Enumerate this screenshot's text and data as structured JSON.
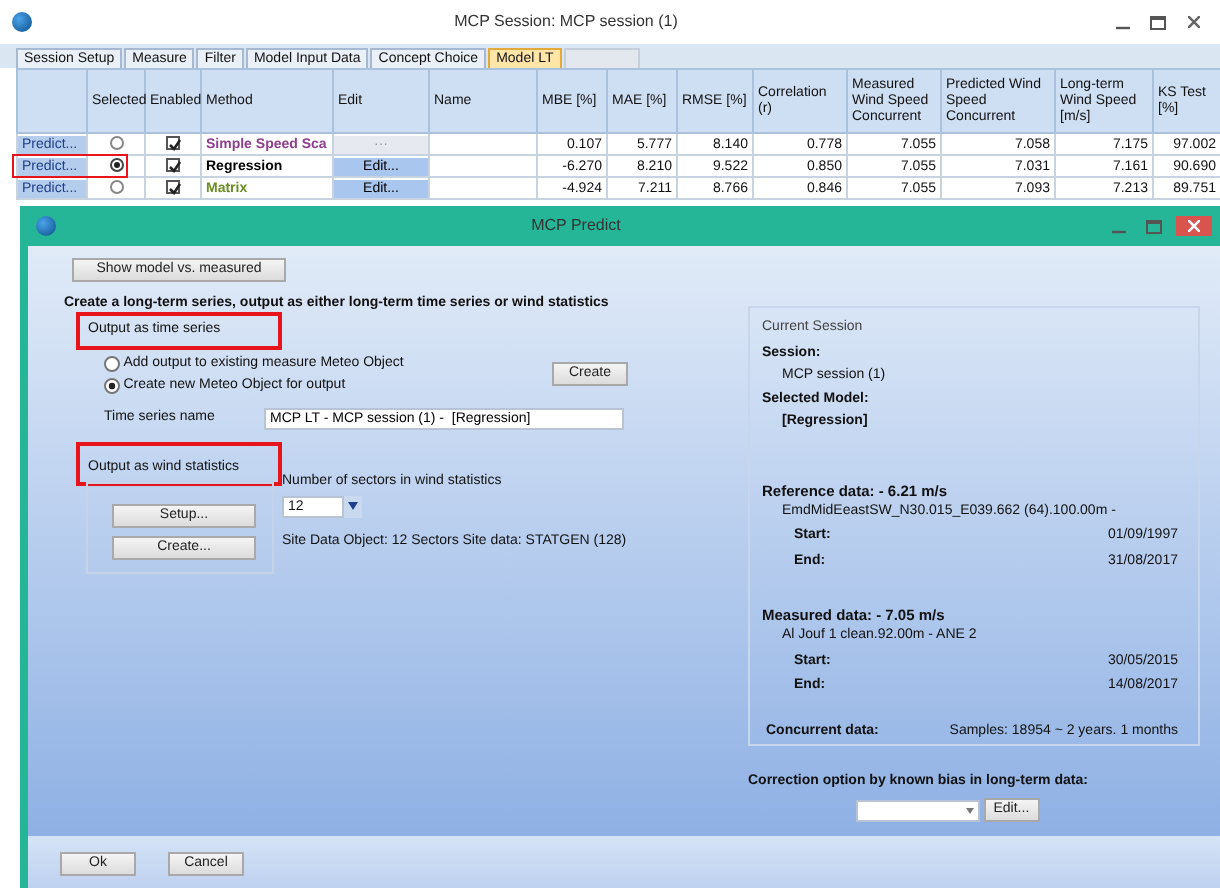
{
  "main_window": {
    "title": "MCP Session: MCP session (1)"
  },
  "tabs": [
    {
      "label": "Session Setup",
      "selected": false
    },
    {
      "label": "Measure",
      "selected": false
    },
    {
      "label": "Filter",
      "selected": false
    },
    {
      "label": "Model Input Data",
      "selected": false
    },
    {
      "label": "Concept Choice",
      "selected": false
    },
    {
      "label": "Model LT",
      "selected": true
    }
  ],
  "table": {
    "columns": [
      "",
      "Selected",
      "Enabled",
      "Method",
      "Edit",
      "Name",
      "MBE [%]",
      "MAE [%]",
      "RMSE [%]",
      "Correlation (r)",
      "Measured Wind Speed Concurrent",
      "Predicted Wind Speed Concurrent",
      "Long-term Wind Speed [m/s]",
      "KS Test [%]"
    ],
    "rows": [
      {
        "button": "Predict...",
        "selected": false,
        "enabled": true,
        "method": "Simple Speed Sca",
        "color": "#8e3f8e",
        "edit": {
          "label": "···",
          "disabled": true
        },
        "values": [
          "0.107",
          "5.777",
          "8.140",
          "0.778",
          "7.055",
          "7.058",
          "7.175",
          "97.002"
        ],
        "highlighted": false
      },
      {
        "button": "Predict...",
        "selected": true,
        "enabled": true,
        "method": "Regression",
        "color": "#000000",
        "edit": {
          "label": "Edit...",
          "disabled": false
        },
        "values": [
          "-6.270",
          "8.210",
          "9.522",
          "0.850",
          "7.055",
          "7.031",
          "7.161",
          "90.690"
        ],
        "highlighted": true
      },
      {
        "button": "Predict...",
        "selected": false,
        "enabled": true,
        "method": "Matrix",
        "color": "#6b8e23",
        "edit": {
          "label": "Edit...",
          "disabled": false
        },
        "values": [
          "-4.924",
          "7.211",
          "8.766",
          "0.846",
          "7.055",
          "7.093",
          "7.213",
          "89.751"
        ],
        "highlighted": false
      }
    ]
  },
  "dialog": {
    "title": "MCP Predict",
    "show_button": "Show model vs. measured",
    "heading": "Create a long-term series, output as either long-term time series or wind statistics",
    "time_series": {
      "label": "Output as time series",
      "highlighted": true,
      "options": [
        {
          "label": "Add output to existing measure Meteo Object",
          "selected": false
        },
        {
          "label": "Create new Meteo Object for output",
          "selected": true
        }
      ],
      "create_button": "Create",
      "name_label": "Time series name",
      "name_value": "MCP LT - MCP session (1) -  [Regression]"
    },
    "wind_statistics": {
      "label": "Output as wind statistics",
      "highlighted": true,
      "setup_button": "Setup...",
      "create_button": "Create...",
      "sectors_label": "Number of sectors in wind statistics",
      "sectors_value": "12",
      "site_info": "Site Data Object: 12 Sectors  Site data: STATGEN (128)"
    },
    "session_panel": {
      "title": "Current Session",
      "session_label": "Session:",
      "session_value": "MCP session (1)",
      "model_label": "Selected Model:",
      "model_value": "[Regression]",
      "data": [
        {
          "heading": "Reference data: - 6.21 m/s",
          "source": "EmdMidEeastSW_N30.015_E039.662 (64).100.00m -",
          "start_label": "Start:",
          "start": "01/09/1997",
          "end_label": "End:",
          "end": "31/08/2017"
        },
        {
          "heading": "Measured data: - 7.05 m/s",
          "source": "Al Jouf 1 clean.92.00m - ANE 2",
          "start_label": "Start:",
          "start": "30/05/2015",
          "end_label": "End:",
          "end": "14/08/2017"
        }
      ],
      "concurrent_label": "Concurrent data:",
      "concurrent_value": "Samples: 18954 ~ 2 years. 1 months"
    },
    "correction": {
      "label": "Correction option by known bias in long-term data:",
      "edit_button": "Edit..."
    },
    "buttons": [
      "Ok",
      "Cancel"
    ]
  }
}
